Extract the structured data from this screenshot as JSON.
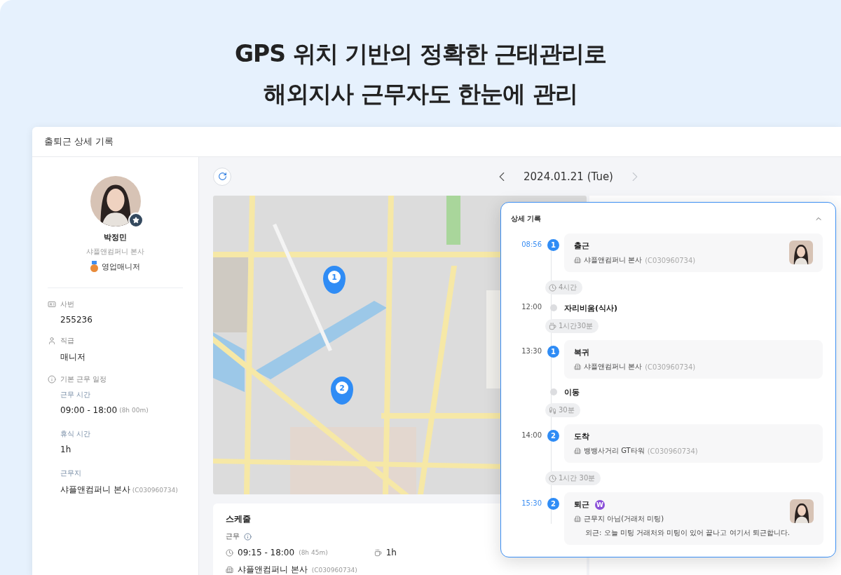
{
  "headline": [
    "GPS 위치 기반의 정확한 근태관리로",
    "해외지사 근무자도 한눈에 관리"
  ],
  "window": {
    "title": "출퇴근 상세 기록"
  },
  "profile": {
    "name": "박정민",
    "company": "샤플앤컴퍼니 본사",
    "role": "영업매니저"
  },
  "info_fields": [
    {
      "kind": "id",
      "label": "사번",
      "value": "255236"
    },
    {
      "kind": "rank",
      "label": "직급",
      "value": "매니저"
    },
    {
      "kind": "schedule",
      "label": "기본 근무 일정",
      "children": [
        {
          "label": "근무 시간",
          "value": "09:00 - 18:00",
          "note": "(8h 00m)"
        },
        {
          "label": "휴식 시간",
          "value": "1h"
        },
        {
          "label": "근무지",
          "value": "샤플앤컴퍼니 본사",
          "note": "(C030960734)"
        }
      ]
    }
  ],
  "date_nav": {
    "label": "2024.01.21 (Tue)",
    "next_disabled": true
  },
  "map": {
    "pins": [
      {
        "label": "1"
      },
      {
        "label": "2"
      }
    ]
  },
  "schedule": {
    "title": "스케줄",
    "type_label": "근무",
    "time": "09:15 - 18:00",
    "duration": "(8h 45m)",
    "break": "1h",
    "place": "샤플앤컴퍼니 본사",
    "code": "(C030960734)"
  },
  "detail": {
    "title": "상세 기록",
    "expanded": true,
    "items": [
      {
        "kind": "card",
        "time": "08:56",
        "highlight": true,
        "step": "1",
        "title": "출근",
        "place": "샤플앤컴퍼니 본사",
        "code": "(C030960734)",
        "photo": true
      },
      {
        "kind": "duration",
        "text": "4시간"
      },
      {
        "kind": "point",
        "time": "12:00",
        "title": "자리비움(식사)"
      },
      {
        "kind": "duration",
        "text": "1시간30분"
      },
      {
        "kind": "card",
        "time": "13:30",
        "highlight": false,
        "step": "1",
        "title": "복귀",
        "place": "샤플앤컴퍼니 본사",
        "code": "(C030960734)",
        "photo": false
      },
      {
        "kind": "point",
        "title": "이동"
      },
      {
        "kind": "duration",
        "text": "30분"
      },
      {
        "kind": "card",
        "time": "14:00",
        "highlight": false,
        "step": "2",
        "title": "도착",
        "place": "뱅뱅사거리 GT타워",
        "code": "(C030960734)",
        "photo": false
      },
      {
        "kind": "duration",
        "text": "1시간 30분"
      },
      {
        "kind": "card",
        "time": "15:30",
        "highlight": true,
        "step": "2",
        "title": "퇴근",
        "badge": "W",
        "place": "근무지 아님(거래처 미팅)",
        "note": "외근: 오늘 미팅 거래처와 미팅이 있어 끝나고 여기서 퇴근합니다.",
        "photo": true
      }
    ]
  }
}
